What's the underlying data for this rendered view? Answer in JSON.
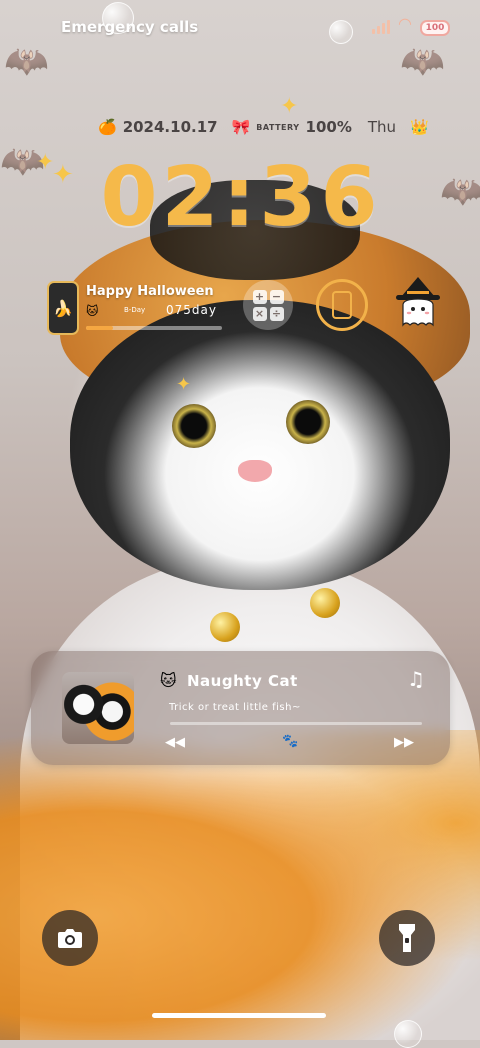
{
  "status_bar": {
    "carrier_text": "Emergency calls",
    "battery_level": "100"
  },
  "lockscreen": {
    "date": "2024.10.17",
    "battery_label": "BATTERY",
    "battery_percent": "100%",
    "weekday": "Thu",
    "time": "02:36"
  },
  "countdown_widget": {
    "title": "Happy Halloween",
    "subtitle": "B-Day",
    "days": "075day",
    "progress": 0.2
  },
  "music_widget": {
    "song_title": "Naughty Cat",
    "lyric": "Trick or treat little fish~",
    "progress": 0
  },
  "icons": {
    "fruit": "🍊",
    "bow": "🎀",
    "crown": "👑",
    "cat": "🐱",
    "phone_sticker": "🍌",
    "note": "♫",
    "prev": "◀◀",
    "next": "▶▶",
    "paw": "🐾"
  }
}
